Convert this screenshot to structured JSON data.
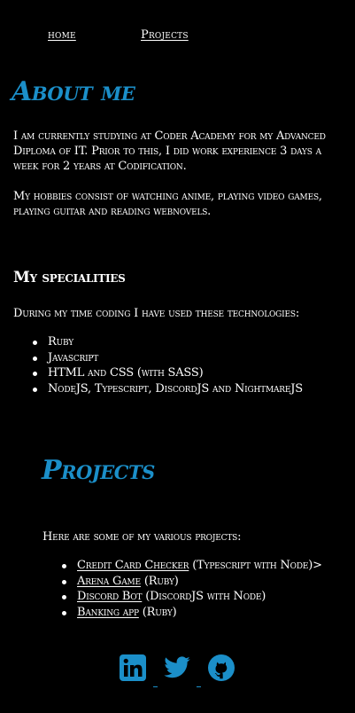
{
  "nav": {
    "home": "home",
    "projects": "Projects"
  },
  "about": {
    "heading": "About me",
    "paragraph1": "I am currently studying at Coder Academy for my Advanced Diploma of IT. Prior to this, I did work experience 3 days a week for 2 years at Codification.",
    "paragraph2": "My hobbies consist of watching anime, playing video games, playing guitar and reading webnovels."
  },
  "specialities": {
    "heading": "My specialities",
    "intro": "During my time coding I have used these technologies:",
    "items": [
      "Ruby",
      "Javascript",
      "HTML and CSS (with SASS)",
      "NodeJS, Typescript, DiscordJS and NightmareJS"
    ]
  },
  "projects": {
    "heading": "Projects",
    "intro": "Here are some of my various projects:",
    "items": [
      {
        "link": "Credit Card Checker",
        "note": " (Typescript with Node)>"
      },
      {
        "link": "Arena Game",
        "note": " (Ruby)"
      },
      {
        "link": "Discord Bot",
        "note": " (DiscordJS with Node)"
      },
      {
        "link": "Banking app",
        "note": " (Ruby)"
      }
    ]
  },
  "social": {
    "icons": [
      "linkedin-icon",
      "twitter-icon",
      "github-icon"
    ],
    "accent": "#1b8fc9"
  },
  "colors": {
    "background": "#000000",
    "text": "#ffffff",
    "heading_accent": "#1b8fc9"
  }
}
